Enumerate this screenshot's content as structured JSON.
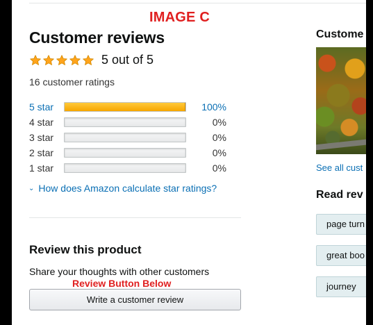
{
  "annotation": {
    "image_label": "IMAGE C",
    "button_note": "Review Button Below"
  },
  "reviews": {
    "title": "Customer reviews",
    "rating_text": "5 out of 5",
    "stars_filled": 5,
    "total_ratings": "16 customer ratings",
    "histogram": [
      {
        "label": "5 star",
        "percent_text": "100%",
        "percent": 100
      },
      {
        "label": "4 star",
        "percent_text": "0%",
        "percent": 0
      },
      {
        "label": "3 star",
        "percent_text": "0%",
        "percent": 0
      },
      {
        "label": "2 star",
        "percent_text": "0%",
        "percent": 0
      },
      {
        "label": "1 star",
        "percent_text": "0%",
        "percent": 0
      }
    ],
    "calc_link": "How does Amazon calculate star ratings?"
  },
  "review_product": {
    "title": "Review this product",
    "subtitle": "Share your thoughts with other customers",
    "button_label": "Write a customer review"
  },
  "right_column": {
    "photos_title": "Custome",
    "see_all": "See all cust",
    "read_reviews_title": "Read rev",
    "chips": [
      "page turn",
      "great boo",
      "journey"
    ]
  },
  "colors": {
    "star": "#FFA41C",
    "link": "#0a6fb4",
    "bar_fill": "#f7a600",
    "annotation": "#e01f1f"
  }
}
